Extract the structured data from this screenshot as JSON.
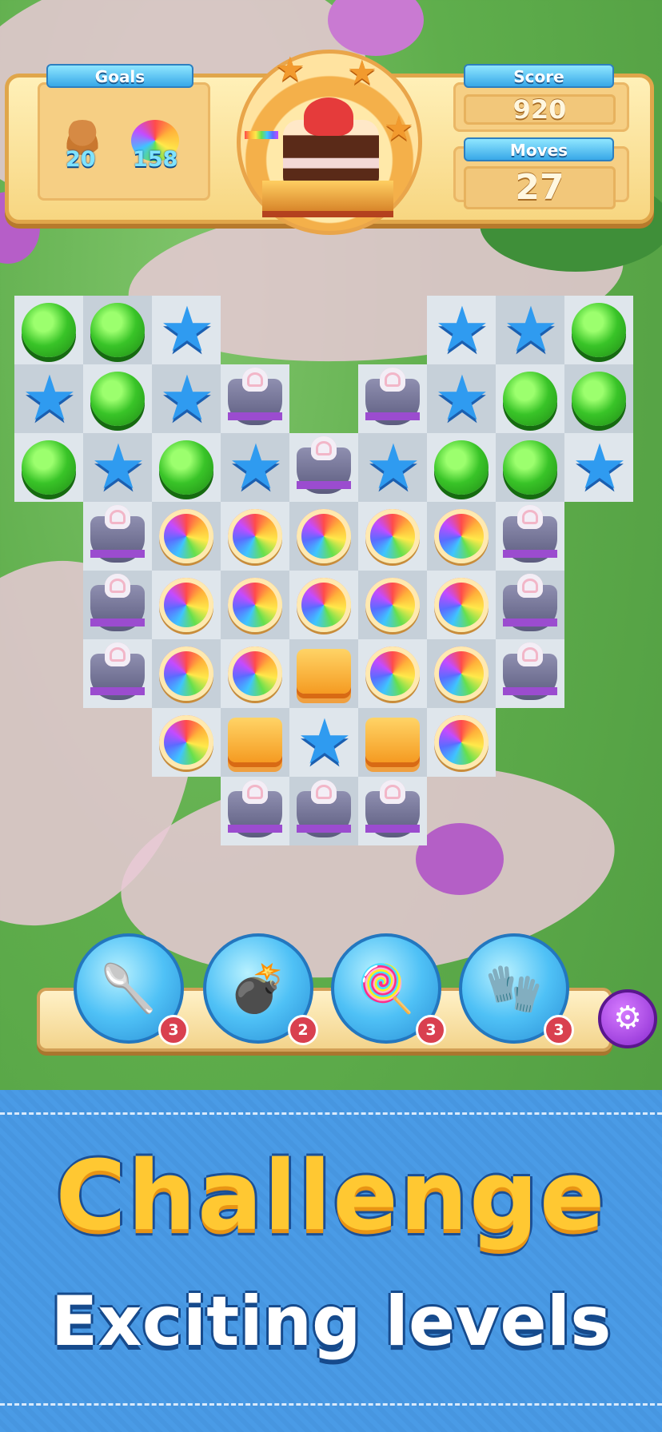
{
  "hud": {
    "goals_label": "Goals",
    "goals": [
      {
        "icon": "gingerbread-icon",
        "count": "20"
      },
      {
        "icon": "rainbow-candy-icon",
        "count": "158"
      }
    ],
    "score_label": "Score",
    "score_value": "920",
    "moves_label": "Moves",
    "moves_value": "27",
    "target_icon": "cake-icon",
    "stars_earned": 3
  },
  "board": {
    "rows": [
      [
        "green",
        "green",
        "blue",
        null,
        null,
        null,
        "blue",
        "blue",
        "green"
      ],
      [
        "blue",
        "green",
        "blue",
        "hat",
        null,
        "hat",
        "blue",
        "green",
        "green"
      ],
      [
        "green",
        "blue",
        "green",
        "blue",
        "hat",
        "blue",
        "green",
        "green",
        "blue"
      ],
      [
        null,
        "hat",
        "rainbow",
        "rainbow",
        "rainbow",
        "rainbow",
        "rainbow",
        "hat",
        null
      ],
      [
        null,
        "hat",
        "rainbow",
        "rainbow",
        "rainbow",
        "rainbow",
        "rainbow",
        "hat",
        null
      ],
      [
        null,
        "hat",
        "rainbow",
        "rainbow",
        "orange",
        "rainbow",
        "rainbow",
        "hat",
        null
      ],
      [
        null,
        null,
        "rainbow",
        "orange",
        "blue",
        "orange",
        "rainbow",
        null,
        null
      ],
      [
        null,
        null,
        null,
        "hat",
        "hat",
        "hat",
        null,
        null,
        null
      ]
    ]
  },
  "boosters": [
    {
      "icon": "spoon-icon",
      "count": "3"
    },
    {
      "icon": "bomb-icon",
      "count": "2"
    },
    {
      "icon": "lollipop-icon",
      "count": "3"
    },
    {
      "icon": "glove-icon",
      "count": "3"
    }
  ],
  "settings_icon": "gear-icon",
  "promo": {
    "headline": "Challenge",
    "subheadline": "Exciting levels"
  }
}
